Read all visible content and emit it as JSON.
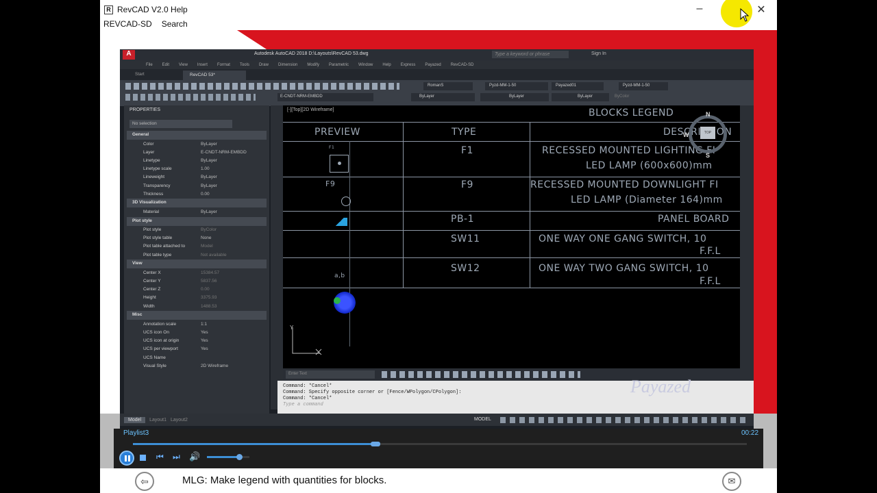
{
  "help_window": {
    "title": "RevCAD V2.0 Help",
    "menu": [
      "REVCAD-SD",
      "Search"
    ],
    "controls": {
      "minimize": "–",
      "maximize": "□",
      "close": "✕"
    }
  },
  "acad": {
    "title": "Autodesk AutoCAD 2018   D:\\Layouts\\RevCAD 53.dwg",
    "search_placeholder": "Type a keyword or phrase",
    "sign_in": "Sign In",
    "menu": [
      "File",
      "Edit",
      "View",
      "Insert",
      "Format",
      "Tools",
      "Draw",
      "Dimension",
      "Modify",
      "Parametric",
      "Window",
      "Help",
      "Express",
      "Payazed",
      "RevCAD-SD"
    ],
    "tabs": [
      "Start",
      "RevCAD 53*"
    ],
    "layer_combo": "E-CNDT-NRM-EMBDD",
    "font_combo": "RomanS",
    "dim_combo": "Pyzd-MM-1-50",
    "table_combo": "Payazed01",
    "ml_combo": "Pyzd-MM-1-50",
    "color_combo": "ByLayer",
    "linetype_combo": "ByLayer",
    "lineweight_combo": "ByLayer",
    "plot_combo": "ByColor"
  },
  "properties": {
    "title": "PROPERTIES",
    "selection": "No selection",
    "sections": [
      {
        "name": "General",
        "rows": [
          [
            "Color",
            "ByLayer"
          ],
          [
            "Layer",
            "E-CNDT-NRM-EMBDD"
          ],
          [
            "Linetype",
            "ByLayer"
          ],
          [
            "Linetype scale",
            "1.00"
          ],
          [
            "Lineweight",
            "ByLayer"
          ],
          [
            "Transparency",
            "ByLayer"
          ],
          [
            "Thickness",
            "0.00"
          ]
        ]
      },
      {
        "name": "3D Visualization",
        "rows": [
          [
            "Material",
            "ByLayer"
          ]
        ]
      },
      {
        "name": "Plot style",
        "rows": [
          [
            "Plot style",
            "ByColor"
          ],
          [
            "Plot style table",
            "None"
          ],
          [
            "Plot table attached to",
            "Model"
          ],
          [
            "Plot table type",
            "Not available"
          ]
        ]
      },
      {
        "name": "View",
        "rows": [
          [
            "Center X",
            "15384.57"
          ],
          [
            "Center Y",
            "5837.56"
          ],
          [
            "Center Z",
            "0.00"
          ],
          [
            "Height",
            "3375.93"
          ],
          [
            "Width",
            "1488.53"
          ]
        ]
      },
      {
        "name": "Misc",
        "rows": [
          [
            "Annotation scale",
            "1:1"
          ],
          [
            "UCS icon On",
            "Yes"
          ],
          [
            "UCS icon at origin",
            "Yes"
          ],
          [
            "UCS per viewport",
            "Yes"
          ],
          [
            "UCS Name",
            ""
          ],
          [
            "Visual Style",
            "2D Wireframe"
          ]
        ]
      }
    ]
  },
  "viewport_label": "[-][Top][2D Wireframe]",
  "legend": {
    "title": "BLOCKS LEGEND",
    "headers": [
      "PREVIEW",
      "TYPE",
      "DESCRIPTION"
    ],
    "rows": [
      {
        "preview": "F1",
        "type": "F1",
        "desc1": "RECESSED MOUNTED LIGHTING FI",
        "desc2": "LED LAMP (600x600)mm"
      },
      {
        "preview": "F9",
        "type": "F9",
        "desc1": "RECESSED MOUNTED DOWNLIGHT FI",
        "desc2": "LED LAMP (Diameter 164)mm"
      },
      {
        "preview": "",
        "type": "PB-1",
        "desc1": "PANEL BOARD",
        "desc2": ""
      },
      {
        "preview": "",
        "type": "SW11",
        "desc1": "ONE WAY ONE GANG SWITCH, 10",
        "desc2": "F.F.L"
      },
      {
        "preview": "a,b",
        "type": "SW12",
        "desc1": "ONE WAY TWO GANG SWITCH, 10",
        "desc2": "F.F.L"
      }
    ]
  },
  "viewcube": {
    "n": "N",
    "s": "S",
    "w": "W",
    "top": "TOP"
  },
  "ucs": {
    "y": "Y",
    "x": "X"
  },
  "enter_text": "Enter Text",
  "command_lines": [
    "Command: *Cancel*",
    "Command: Specify opposite corner or [Fence/WPolygon/CPolygon]:",
    "Command: *Cancel*"
  ],
  "command_placeholder": "Type a command",
  "watermark": "Payazed",
  "model_tabs": [
    "Model",
    "Layout1",
    "Layout2"
  ],
  "status_model": "MODEL",
  "status_scale": "1:1",
  "player": {
    "playlist": "Playlist3",
    "time": "00:22",
    "progress": 0.395,
    "volume": 0.75
  },
  "caption": "MLG: Make legend with quantities for blocks."
}
